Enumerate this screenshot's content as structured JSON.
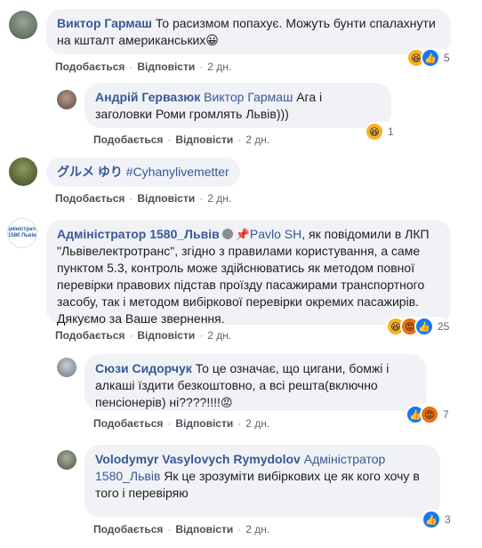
{
  "actions": {
    "like": "Подобається",
    "reply": "Відповісти",
    "sep": "·"
  },
  "comments": [
    {
      "author": "Виктор Гармаш",
      "text": "То расизмом попахує. Можуть бунти спалахнути на кшталт американських",
      "emoji": "😀",
      "time": "2 дн.",
      "reactions": {
        "icons": [
          "haha-icon",
          "like-icon"
        ],
        "count": "5"
      }
    },
    {
      "author": "Андрій Гервазюк",
      "mention": "Виктор Гармаш",
      "text": "Ага і заголовки Роми громлять Львів)))",
      "time": "2 дн.",
      "reactions": {
        "icons": [
          "haha-icon"
        ],
        "count": "1"
      }
    },
    {
      "author": "グルメ ゆり",
      "mention": "#Cyhanylivemetter",
      "time": "2 дн."
    },
    {
      "author": "Адміністратор 1580_Львів",
      "avatar_text": "Адміністратор 1580 Львів",
      "mention": "Pavlo SH",
      "text": ", як повідомили в ЛКП \"Львівелектротранс\", згідно з правилами користування, а саме пунктом 5.3, контроль може здійснюватись як методом повної перевірки правових підстав проїзду пасажирами транспортного засобу, так і методом вибіркової перевірки окремих пасажирів. Дякуємо за Ваше звернення.",
      "time": "2 дн.",
      "reactions": {
        "icons": [
          "haha-icon",
          "angry-icon",
          "like-icon"
        ],
        "count": "25"
      }
    },
    {
      "author": "Сюзи Сидорчук",
      "text": "То це означає, що цигани, бомжі і алкаші їздити безкоштовно, а всі решта(включно пенсіонерів) ні????!!!!",
      "time": "2 дн.",
      "reactions": {
        "icons": [
          "like-icon",
          "angry-icon"
        ],
        "count": "7"
      }
    },
    {
      "author": "Volodymyr Vasylovych Rymydolov",
      "mention": "Адміністратор 1580_Львів",
      "text": "Як це зрозуміти вибіркових це як кого хочу в того і перевіряю",
      "time": "2 дн.",
      "reactions": {
        "icons": [
          "like-icon"
        ],
        "count": "3"
      }
    }
  ]
}
